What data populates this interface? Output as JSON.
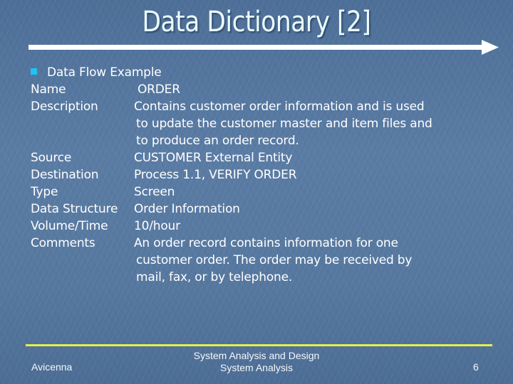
{
  "slide": {
    "title": "Data Dictionary [2]",
    "bullet_heading": "Data Flow Example",
    "entries": [
      {
        "label": "Name",
        "lines": [
          "ORDER"
        ]
      },
      {
        "label": "Description",
        "lines": [
          "Contains customer order information and is used",
          "to update the customer master and item files and",
          "to produce an order record."
        ]
      },
      {
        "label": "Source",
        "lines": [
          "CUSTOMER External Entity"
        ]
      },
      {
        "label": "Destination",
        "lines": [
          "Process 1.1, VERIFY ORDER"
        ]
      },
      {
        "label": "Type",
        "lines": [
          "Screen"
        ]
      },
      {
        "label": "Data Structure",
        "lines": [
          "Order Information"
        ]
      },
      {
        "label": "Volume/Time",
        "lines": [
          "10/hour"
        ]
      },
      {
        "label": "Comments",
        "lines": [
          "An order record contains information for one",
          "customer order.  The order may be received by",
          "mail, fax, or by telephone."
        ]
      }
    ]
  },
  "footer": {
    "left": "Avicenna",
    "center_line1": "System Analysis and Design",
    "center_line2": "System Analysis",
    "page_number": "6"
  },
  "colors": {
    "background": "#53769e",
    "bullet": "#1fc3f5",
    "footer_rule": "#e1f04a",
    "title": "#eafcff"
  }
}
